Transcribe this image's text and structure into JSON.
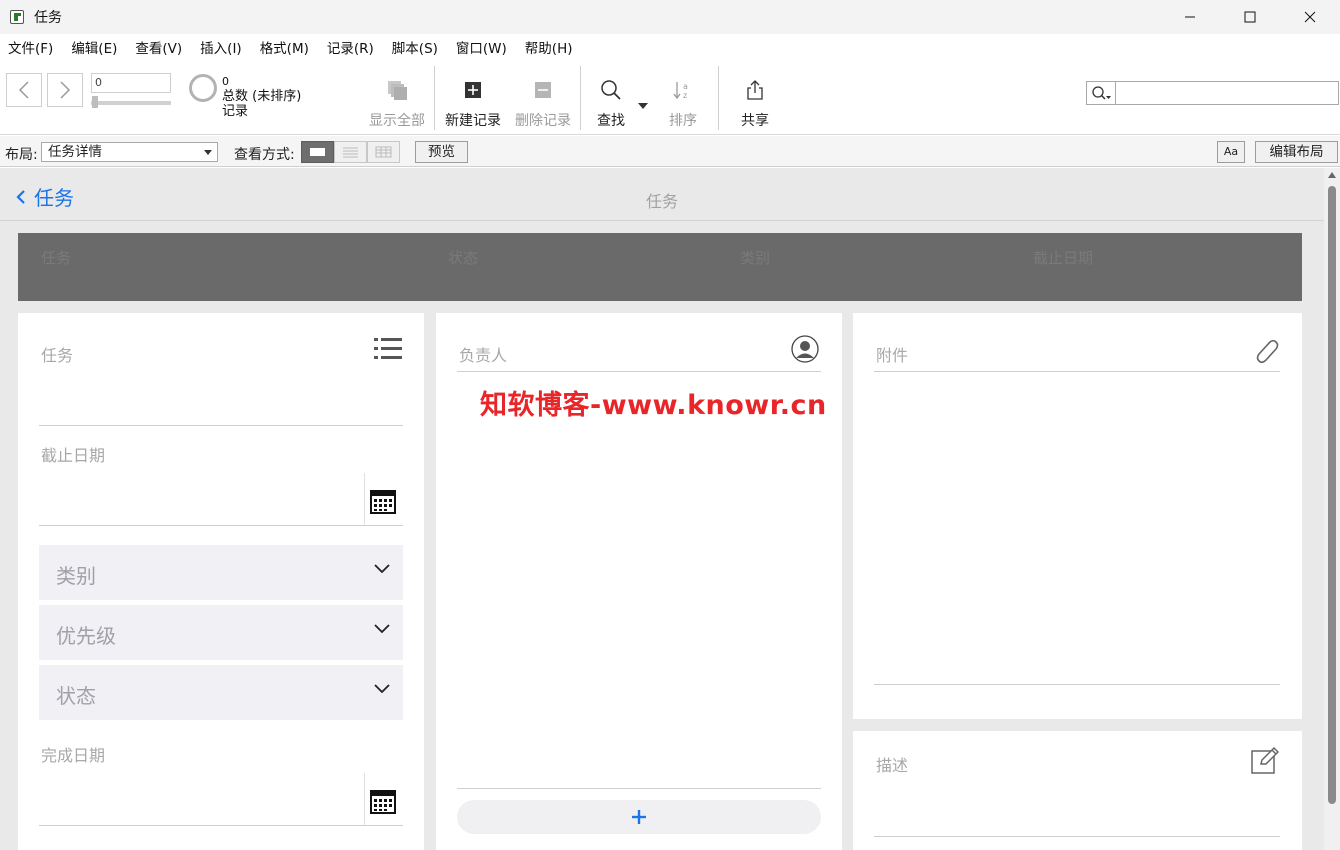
{
  "window": {
    "title": "任务"
  },
  "menu": [
    "文件(F)",
    "编辑(E)",
    "查看(V)",
    "插入(I)",
    "格式(M)",
    "记录(R)",
    "脚本(S)",
    "窗口(W)",
    "帮助(H)"
  ],
  "toolbar": {
    "record_value": "0",
    "count_value": "0",
    "count_label": "总数 (未排序)",
    "records_label": "记录",
    "show_all": "显示全部",
    "new_record": "新建记录",
    "delete_record": "删除记录",
    "find": "查找",
    "sort": "排序",
    "share": "共享"
  },
  "layoutbar": {
    "layout_label": "布局:",
    "layout_value": "任务详情",
    "view_label": "查看方式:",
    "preview": "预览",
    "font_btn": "Aa",
    "edit_layout": "编辑布局"
  },
  "content": {
    "back_label": "任务",
    "page_title": "任务",
    "header_columns": [
      "任务",
      "状态",
      "类别",
      "截止日期"
    ],
    "left_panel": {
      "task_label": "任务",
      "due_label": "截止日期",
      "dropdowns": [
        "类别",
        "优先级",
        "状态"
      ],
      "done_label": "完成日期"
    },
    "middle_panel": {
      "assignee_label": "负责人",
      "add_symbol": "+"
    },
    "right_panel": {
      "attachment_label": "附件",
      "description_label": "描述"
    }
  },
  "watermark": "知软博客-www.knowr.cn"
}
